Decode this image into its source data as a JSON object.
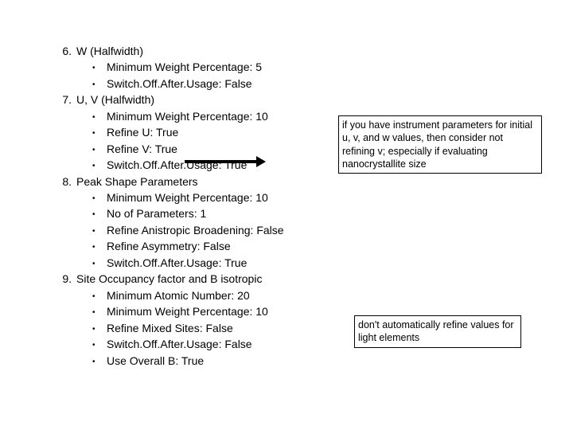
{
  "items": [
    {
      "num": "6.",
      "title": "W (Halfwidth)",
      "subs": [
        "Minimum Weight Percentage: 5",
        "Switch.Off.After.Usage: False"
      ]
    },
    {
      "num": "7.",
      "title": "U, V (Halfwidth)",
      "subs": [
        "Minimum Weight Percentage: 10",
        "Refine U: True",
        "Refine V: True",
        "Switch.Off.After.Usage: True"
      ]
    },
    {
      "num": "8.",
      "title": "Peak Shape Parameters",
      "subs": [
        "Minimum Weight Percentage: 10",
        "No of Parameters: 1",
        "Refine Anistropic Broadening: False",
        "Refine Asymmetry: False",
        "Switch.Off.After.Usage: True"
      ]
    },
    {
      "num": "9.",
      "title": "Site Occupancy factor and B isotropic",
      "subs": [
        "Minimum Atomic Number: 20",
        "Minimum Weight Percentage: 10",
        "Refine Mixed Sites: False",
        "Switch.Off.After.Usage: False",
        "Use Overall B: True"
      ]
    }
  ],
  "notes": {
    "note1": "if you have instrument parameters for initial u, v, and w values, then consider not refining v; especially if evaluating nanocrystallite size",
    "note2": "don't automatically refine values for light elements"
  }
}
